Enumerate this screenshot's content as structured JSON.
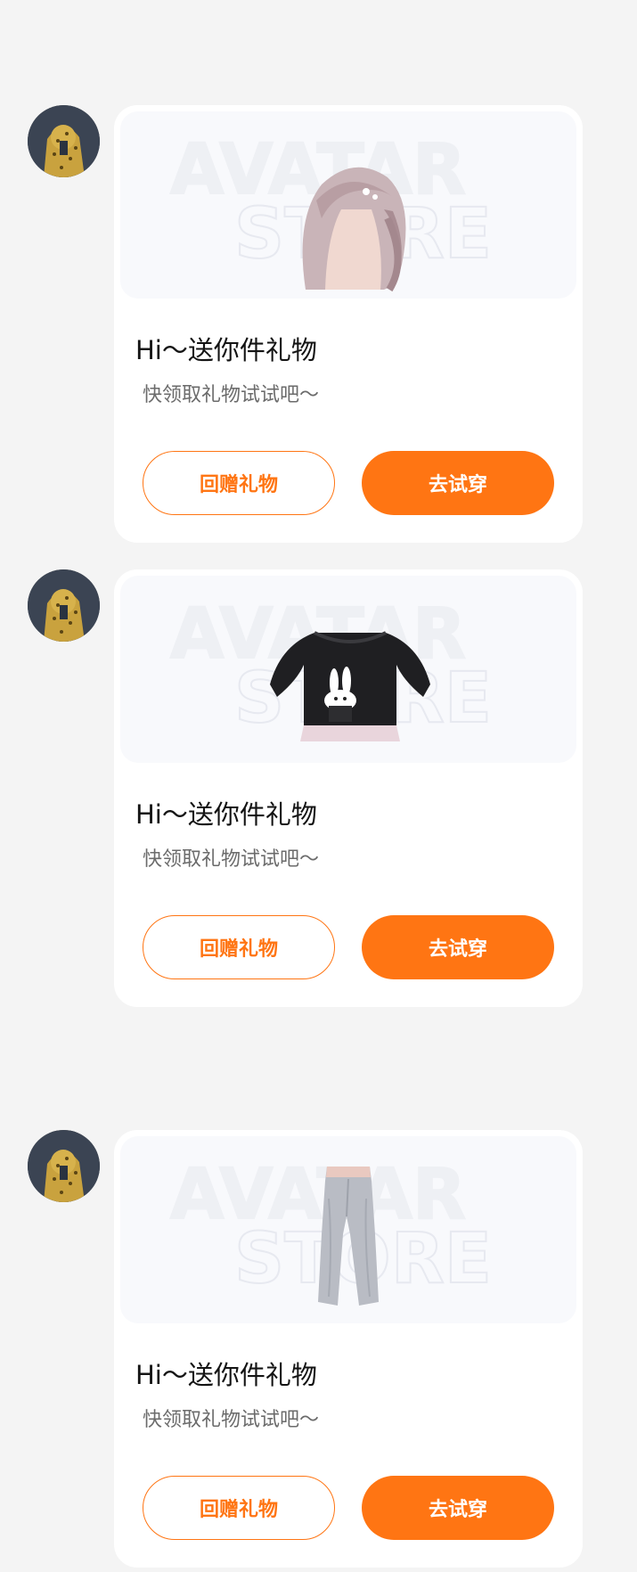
{
  "colors": {
    "page_background": "#f4f4f4",
    "card_background": "#ffffff",
    "banner_background": "#f8f9fc",
    "accent": "#ff7513",
    "title_text": "#141414",
    "subtitle_text": "#6b6b6b"
  },
  "messages": [
    {
      "avatar_icon": "user-avatar-yellow-hoodie",
      "item_icon": "hair-item-icon",
      "watermark_top": "AVATAR",
      "watermark_bottom": "STORE",
      "title": "Hi～送你件礼物",
      "subtitle": "快领取礼物试试吧～",
      "return_gift_label": "回赠礼物",
      "try_on_label": "去试穿"
    },
    {
      "avatar_icon": "user-avatar-yellow-hoodie",
      "item_icon": "sweater-item-icon",
      "watermark_top": "AVATAR",
      "watermark_bottom": "STORE",
      "title": "Hi～送你件礼物",
      "subtitle": "快领取礼物试试吧～",
      "return_gift_label": "回赠礼物",
      "try_on_label": "去试穿"
    },
    {
      "avatar_icon": "user-avatar-yellow-hoodie",
      "item_icon": "pants-item-icon",
      "watermark_top": "AVATAR",
      "watermark_bottom": "STORE",
      "title": "Hi～送你件礼物",
      "subtitle": "快领取礼物试试吧～",
      "return_gift_label": "回赠礼物",
      "try_on_label": "去试穿"
    }
  ]
}
